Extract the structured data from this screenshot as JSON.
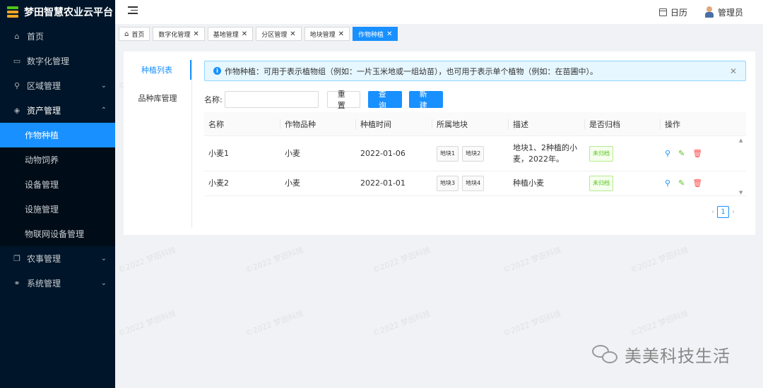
{
  "app": {
    "title": "梦田智慧农业云平台"
  },
  "sidebar": {
    "items": [
      {
        "label": "首页",
        "icon": "home-icon"
      },
      {
        "label": "数字化管理",
        "icon": "monitor-icon"
      },
      {
        "label": "区域管理",
        "icon": "location-icon"
      },
      {
        "label": "资产管理",
        "icon": "layers-icon"
      },
      {
        "label": "农事管理",
        "icon": "cube-icon"
      },
      {
        "label": "系统管理",
        "icon": "link-icon"
      }
    ],
    "sub_items": [
      {
        "label": "作物种植",
        "active": true
      },
      {
        "label": "动物饲养"
      },
      {
        "label": "设备管理"
      },
      {
        "label": "设施管理"
      },
      {
        "label": "物联网设备管理"
      }
    ]
  },
  "header": {
    "calendar_label": "日历",
    "user_label": "管理员"
  },
  "tabs": [
    {
      "label": "首页"
    },
    {
      "label": "数字化管理"
    },
    {
      "label": "基地管理"
    },
    {
      "label": "分区管理"
    },
    {
      "label": "地块管理"
    },
    {
      "label": "作物种植",
      "active": true
    }
  ],
  "subnav": {
    "items": [
      {
        "label": "种植列表",
        "active": true
      },
      {
        "label": "品种库管理"
      }
    ]
  },
  "alert": {
    "text": "作物种植：可用于表示植物组（例如：一片玉米地或一组幼苗），也可用于表示单个植物（例如：在苗圃中）。"
  },
  "filter": {
    "name_label": "名称:",
    "name_value": "",
    "reset_label": "重置",
    "search_label": "查询",
    "new_label": "新建"
  },
  "table": {
    "headers": [
      "名称",
      "作物品种",
      "种植时间",
      "所属地块",
      "描述",
      "是否归档",
      "操作"
    ],
    "rows": [
      {
        "name": "小麦1",
        "variety": "小麦",
        "date": "2022-01-06",
        "plots": [
          "地块1",
          "地块2"
        ],
        "desc_l1": "地块1、2种植的小",
        "desc_l2": "麦，2022年。",
        "status": "未归档"
      },
      {
        "name": "小麦2",
        "variety": "小麦",
        "date": "2022-01-01",
        "plots": [
          "地块3",
          "地块4"
        ],
        "desc_l1": "种植小麦",
        "desc_l2": "",
        "status": "未归档"
      }
    ]
  },
  "pager": {
    "current": "1"
  },
  "watermark": "©2022 梦田科技",
  "brand_footer": "美美科技生活",
  "colors": {
    "primary": "#1890ff",
    "sidebar_bg": "#001529",
    "success": "#52c41a",
    "danger": "#ff4d4f"
  }
}
